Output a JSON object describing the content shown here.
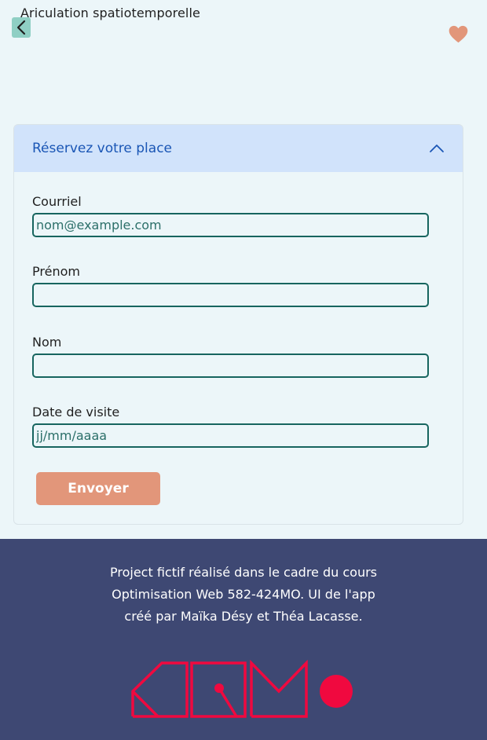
{
  "header": {
    "title": "Ariculation spatiotemporelle",
    "back_icon": "chevron-left-icon",
    "favorite_icon": "heart-icon"
  },
  "reservation": {
    "header_title": "Réservez votre place",
    "toggle_icon": "chevron-up-icon",
    "fields": {
      "email": {
        "label": "Courriel",
        "value": "",
        "placeholder": "nom@example.com"
      },
      "firstname": {
        "label": "Prénom",
        "value": "",
        "placeholder": ""
      },
      "lastname": {
        "label": "Nom",
        "value": "",
        "placeholder": ""
      },
      "visit_date": {
        "label": "Date de visite",
        "value": "",
        "placeholder": "jj/mm/aaaa"
      }
    },
    "submit_label": "Envoyer"
  },
  "footer": {
    "lines": [
      "Project fictif réalisé dans le cadre du cours",
      "Optimisation Web 582-424MO. UI de l'app",
      "créé par Maïka Désy et Théa Lacasse."
    ],
    "logo_icon": "aqm-logo"
  },
  "colors": {
    "background": "#ecf6f9",
    "accent_header_bg": "#d1e3fb",
    "accent_header_text": "#1a56b5",
    "input_border": "#17655f",
    "button": "#e2967a",
    "heart": "#e2967a",
    "back_button": "#8fcfc4",
    "footer_bg": "#3e4873",
    "logo_red": "#f0093f"
  }
}
